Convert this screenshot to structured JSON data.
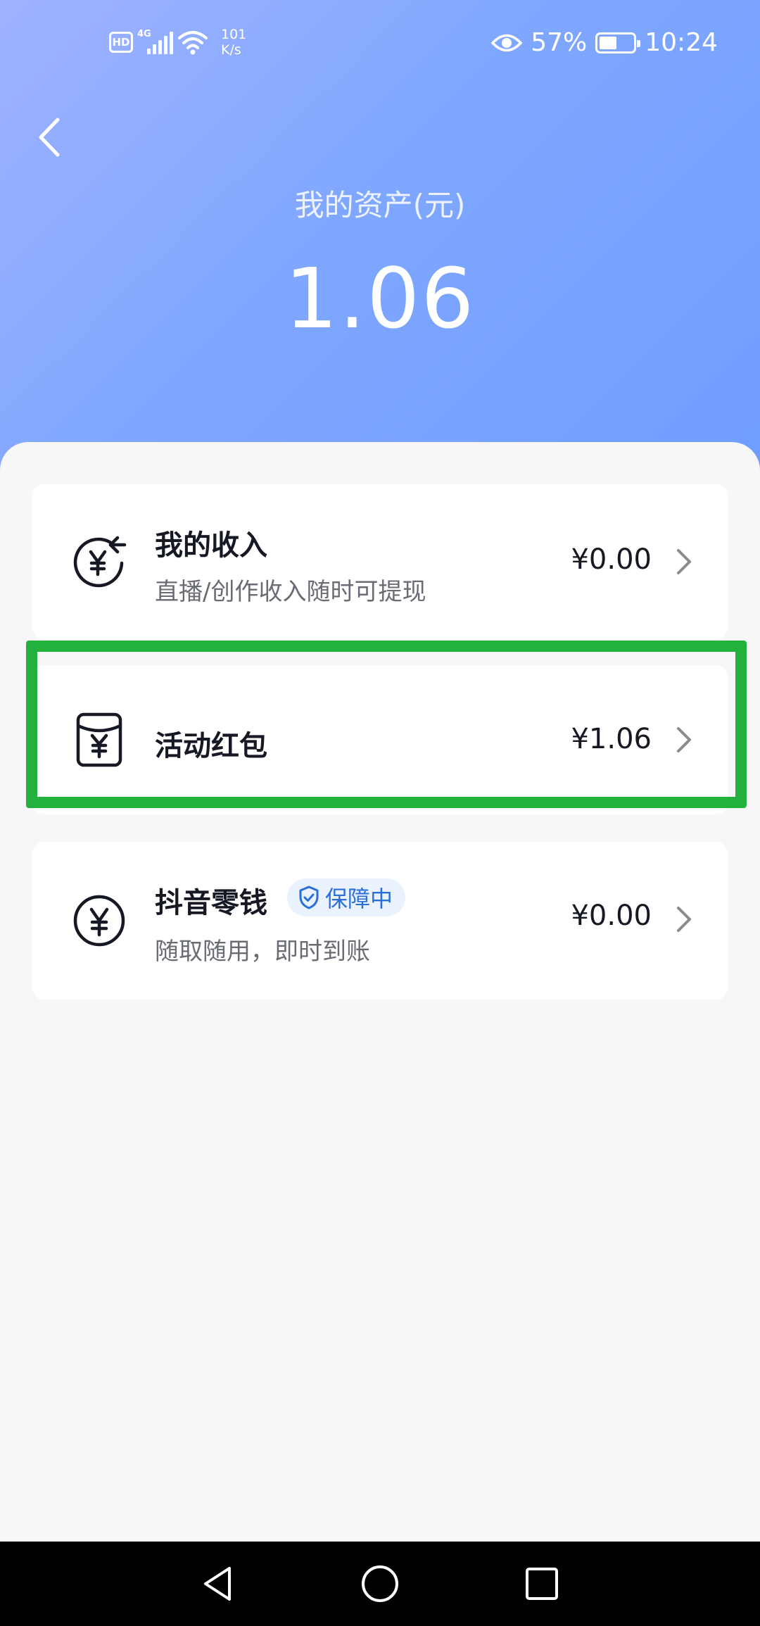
{
  "status_bar": {
    "hd": "HD",
    "network": "4G",
    "speed_value": "101",
    "speed_unit": "K/s",
    "battery_percent": "57%",
    "battery_level": 0.57,
    "time": "10:24"
  },
  "header": {
    "title": "我的资产(元)",
    "total": "1.06"
  },
  "cards": [
    {
      "title": "我的收入",
      "subtitle": "直播/创作收入随时可提现",
      "amount": "¥0.00"
    },
    {
      "title": "活动红包",
      "amount": "¥1.06"
    },
    {
      "title": "抖音零钱",
      "badge": "保障中",
      "subtitle": "随取随用，即时到账",
      "amount": "¥0.00"
    }
  ],
  "colors": {
    "header_gradient_start": "#9fb2ff",
    "header_gradient_end": "#6f9dff",
    "highlight": "#22b13d",
    "badge_text": "#2c6fd8",
    "badge_bg": "#e9f2fd"
  }
}
